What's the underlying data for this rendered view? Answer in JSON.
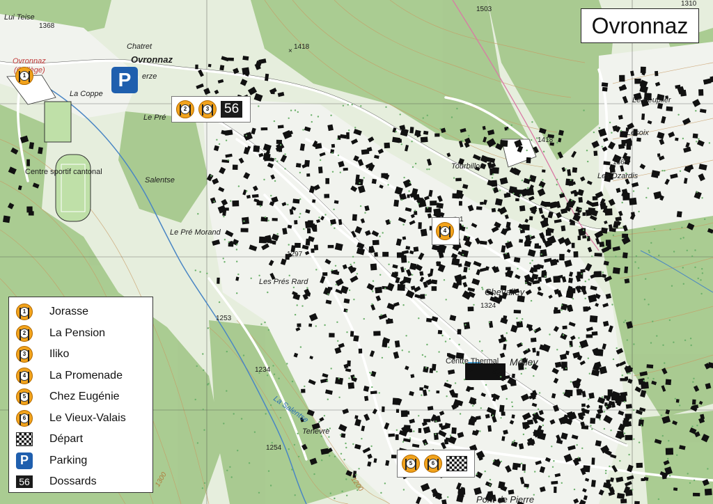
{
  "title": "Ovronnaz",
  "markers": {
    "top": {
      "restos": [
        "2",
        "3"
      ],
      "bib": "56"
    },
    "center": {
      "restos": [
        "4"
      ]
    },
    "bottom": {
      "restos": [
        "5",
        "6"
      ]
    },
    "topleft": {
      "restos": [
        "1"
      ]
    }
  },
  "parking_label": "P",
  "place_names": {
    "lui_teise": "Lui Teise",
    "ovronnaz_village": "Ovronnaz",
    "ovronnaz_college": "Ovronnaz",
    "college_paren": "(Collège)",
    "chatret": "Chatret",
    "erze": "erze",
    "la_coppe": "La Coppe",
    "le_pre": "Le Pré",
    "centre_sportif": "Centre sportif cantonal",
    "salentse": "Salentse",
    "le_pre_morand": "Le Pré Morand",
    "les_pres_rard": "Les Prés Rard",
    "tourbillon": "Tourbillon",
    "chevalley": "Chevalley",
    "centre_thermal": "Centre Thermal",
    "melley": "Melley",
    "le_peuplier": "Le Peuplier",
    "lesoix": "Lesoix",
    "les_dzardis": "Les Dzardis",
    "tenevre": "Tenevre",
    "pont_de_pierre": "Pont de Pierre",
    "la_salentse": "La Salentse"
  },
  "altitudes": {
    "a1368": "1368",
    "a1418a": "1418",
    "a1503": "1503",
    "a1310": "1310",
    "a1418b": "1418",
    "a1362": "1362",
    "a1297": "1297",
    "a1324": "1324",
    "a1253": "1253",
    "a1234": "1234",
    "a1254": "1254",
    "c1300": "1300",
    "c1200": "1200",
    "pt1": "1"
  },
  "legend": {
    "items": [
      {
        "symbol": "resto",
        "num": "1",
        "label": "Jorasse"
      },
      {
        "symbol": "resto",
        "num": "2",
        "label": "La Pension"
      },
      {
        "symbol": "resto",
        "num": "3",
        "label": "Iliko"
      },
      {
        "symbol": "resto",
        "num": "4",
        "label": "La Promenade"
      },
      {
        "symbol": "resto",
        "num": "5",
        "label": "Chez Eugénie"
      },
      {
        "symbol": "resto",
        "num": "6",
        "label": "Le Vieux-Valais"
      },
      {
        "symbol": "flag",
        "label": "Départ"
      },
      {
        "symbol": "parking",
        "glyph": "P",
        "label": "Parking"
      },
      {
        "symbol": "bib",
        "glyph": "56",
        "label": "Dossards"
      }
    ]
  },
  "colors": {
    "forest": "#a9cc8f",
    "meadow": "#e8efe0",
    "restaurant": "#f2a31c",
    "parking": "#1f5fae",
    "water": "#2a6fb3"
  }
}
